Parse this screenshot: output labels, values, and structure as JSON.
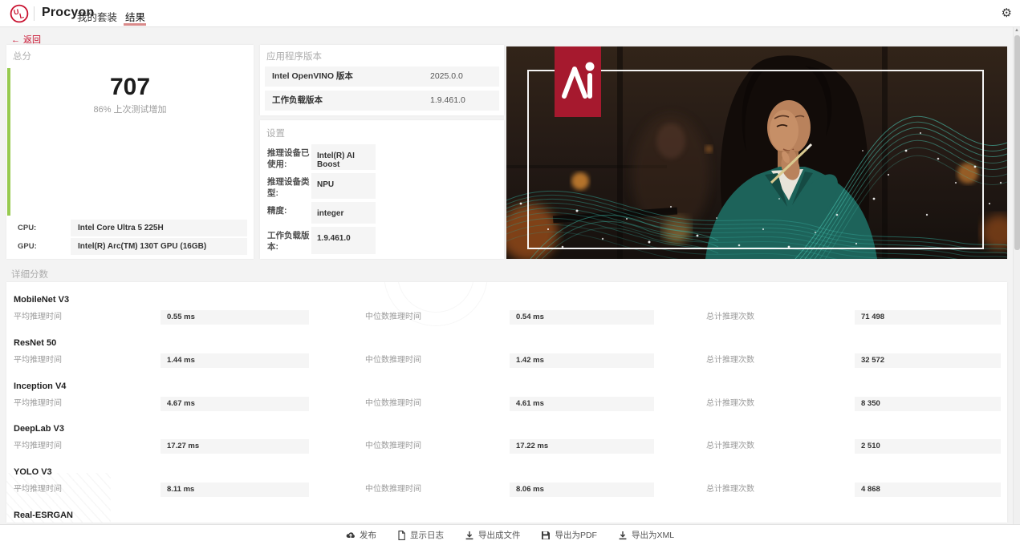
{
  "header": {
    "brand": "Procyon",
    "nav": [
      {
        "label": "我的套装"
      },
      {
        "label": "结果"
      }
    ]
  },
  "back_label": "返回",
  "score_card": {
    "title": "总分",
    "score": "707",
    "subtitle": "86% 上次测试增加",
    "cpu_label": "CPU:",
    "cpu_value": "Intel Core Ultra 5 225H",
    "gpu_label": "GPU:",
    "gpu_value": "Intel(R) Arc(TM) 130T GPU (16GB)"
  },
  "version_card": {
    "title": "应用程序版本",
    "rows": [
      {
        "label": "Intel OpenVINO 版本",
        "value": "2025.0.0"
      },
      {
        "label": "工作负载版本",
        "value": "1.9.461.0"
      }
    ]
  },
  "settings_card": {
    "title": "设置",
    "rows": [
      {
        "label": "推理设备已使用:",
        "value": "Intel(R) AI Boost"
      },
      {
        "label": "推理设备类型:",
        "value": "NPU"
      },
      {
        "label": "精度:",
        "value": "integer"
      },
      {
        "label": "工作负载版本:",
        "value": "1.9.461.0"
      }
    ]
  },
  "details": {
    "title": "详细分数",
    "labels": {
      "avg": "平均推理时间",
      "median": "中位数推理时间",
      "total": "总计推理次数"
    },
    "models": [
      {
        "name": "MobileNet V3",
        "avg": "0.55 ms",
        "median": "0.54 ms",
        "total": "71 498"
      },
      {
        "name": "ResNet 50",
        "avg": "1.44 ms",
        "median": "1.42 ms",
        "total": "32 572"
      },
      {
        "name": "Inception V4",
        "avg": "4.67 ms",
        "median": "4.61 ms",
        "total": "8 350"
      },
      {
        "name": "DeepLab V3",
        "avg": "17.27 ms",
        "median": "17.22 ms",
        "total": "2 510"
      },
      {
        "name": "YOLO V3",
        "avg": "8.11 ms",
        "median": "8.06 ms",
        "total": "4 868"
      },
      {
        "name": "Real-ESRGAN"
      }
    ]
  },
  "footer": {
    "items": [
      {
        "label": "发布",
        "icon": "cloud-upload"
      },
      {
        "label": "显示日志",
        "icon": "log-file"
      },
      {
        "label": "导出成文件",
        "icon": "download"
      },
      {
        "label": "导出为PDF",
        "icon": "save-pdf"
      },
      {
        "label": "导出为XML",
        "icon": "download-xml"
      }
    ]
  },
  "colors": {
    "brand_red": "#c8102e",
    "score_green": "#97ca50",
    "tab_underline": "#d98a8a",
    "badge_red": "#a6192e",
    "mesh_teal": "#49c5b1",
    "value_box_bg": "#f5f5f5"
  }
}
